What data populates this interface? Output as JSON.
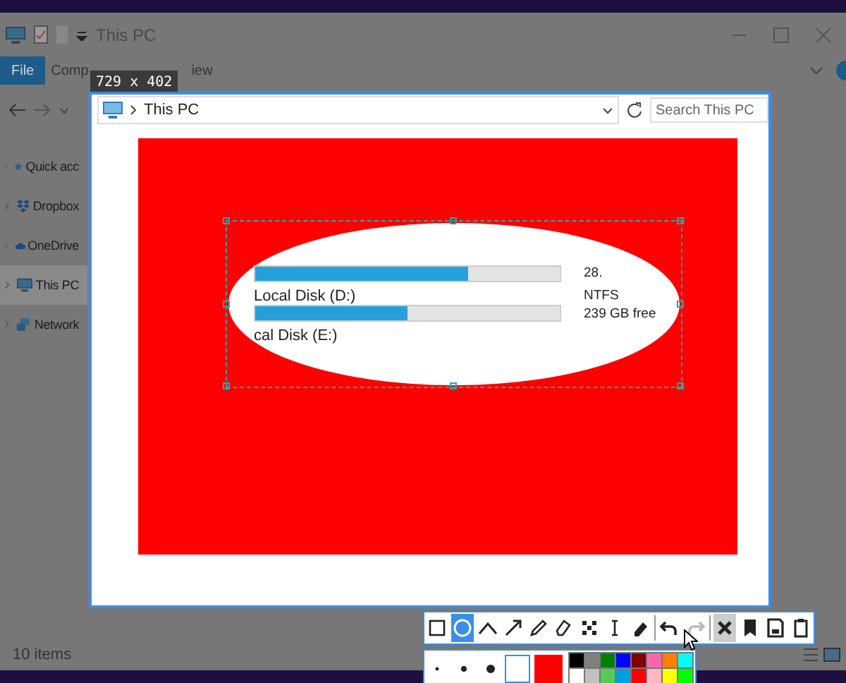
{
  "explorer": {
    "title": "This PC",
    "ribbon_tabs": [
      {
        "label": "File",
        "selected": true
      },
      {
        "label": "Comp",
        "selected": false
      },
      {
        "label": "iew",
        "selected": false
      }
    ],
    "sidebar": [
      {
        "kind": "star",
        "label": "Quick acc",
        "selected": false
      },
      {
        "kind": "dropbox",
        "label": "Dropbox",
        "selected": false
      },
      {
        "kind": "cloud",
        "label": "OneDrive",
        "selected": false
      },
      {
        "kind": "pc",
        "label": "This PC",
        "selected": true
      },
      {
        "kind": "network",
        "label": "Network",
        "selected": false
      }
    ],
    "status_bar": "10 items"
  },
  "capture": {
    "size_label": "729 x 402",
    "address": "This PC",
    "search": {
      "placeholder": "Search This PC"
    },
    "drives": [
      {
        "level": 0.7,
        "detail": "28."
      },
      {
        "name": "Local Disk (D:)",
        "filesystem": "NTFS",
        "level": 0.5,
        "detail": "239 GB free"
      },
      {
        "name": "cal Disk (E:)"
      }
    ]
  },
  "toolbar": {
    "tools": [
      {
        "kind": "rectangle",
        "selected": false
      },
      {
        "kind": "ellipse",
        "selected": true
      },
      {
        "kind": "line",
        "selected": false
      },
      {
        "kind": "arrow",
        "selected": false
      },
      {
        "kind": "pencil",
        "selected": false
      },
      {
        "kind": "marker",
        "selected": false
      },
      {
        "kind": "mosaic",
        "selected": false
      },
      {
        "kind": "text",
        "selected": false
      },
      {
        "kind": "eraser",
        "selected": false
      }
    ],
    "actions": [
      {
        "kind": "undo",
        "disabled": false
      },
      {
        "kind": "redo",
        "disabled": true
      },
      {
        "kind": "cancel",
        "disabled": false
      },
      {
        "kind": "pin",
        "disabled": false
      },
      {
        "kind": "save",
        "disabled": false
      },
      {
        "kind": "copy",
        "disabled": false
      }
    ]
  },
  "brush": {
    "sizes": [
      {
        "kind": "small"
      },
      {
        "kind": "medium"
      },
      {
        "kind": "large"
      }
    ],
    "fill_pattern": {
      "selected": true
    },
    "current_swatch": {
      "color": "#ff0000"
    },
    "palette": [
      {
        "color": "#000000"
      },
      {
        "color": "#808080"
      },
      {
        "color": "#008000"
      },
      {
        "color": "#0000ff"
      },
      {
        "color": "#800000"
      },
      {
        "color": "#ff66aa"
      },
      {
        "color": "#ff8000"
      },
      {
        "color": "#00ffff"
      },
      {
        "color": "#ffffff"
      },
      {
        "color": "#c0c0c0"
      },
      {
        "color": "#55cc55"
      },
      {
        "color": "#00a0e0"
      },
      {
        "color": "#ff0000"
      },
      {
        "color": "#ffb6c1"
      },
      {
        "color": "#ffff00"
      },
      {
        "color": "#00ff00"
      }
    ]
  }
}
